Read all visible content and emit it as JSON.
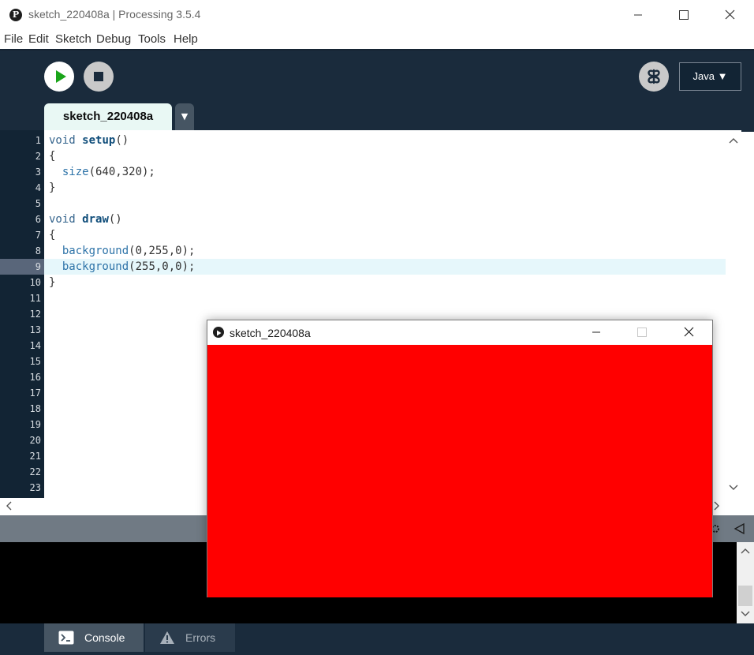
{
  "window": {
    "title": "sketch_220408a | Processing 3.5.4"
  },
  "menu": [
    "File",
    "Edit",
    "Sketch",
    "Debug",
    "Tools",
    "Help"
  ],
  "toolbar": {
    "mode": "Java ▼"
  },
  "tabs": {
    "active": "sketch_220408a",
    "menu_arrow": "▼"
  },
  "editor": {
    "line_numbers": [
      "1",
      "2",
      "3",
      "4",
      "5",
      "6",
      "7",
      "8",
      "9",
      "10",
      "11",
      "12",
      "13",
      "14",
      "15",
      "16",
      "17",
      "18",
      "19",
      "20",
      "21",
      "22",
      "23"
    ],
    "current_line": 9,
    "code": [
      [
        {
          "t": "void ",
          "c": "kw"
        },
        {
          "t": "setup",
          "c": "fn"
        },
        {
          "t": "()",
          "c": ""
        }
      ],
      [
        {
          "t": "{",
          "c": ""
        }
      ],
      [
        {
          "t": "  ",
          "c": ""
        },
        {
          "t": "size",
          "c": "fn2"
        },
        {
          "t": "(640,320);",
          "c": ""
        }
      ],
      [
        {
          "t": "}",
          "c": ""
        }
      ],
      [],
      [
        {
          "t": "void ",
          "c": "kw"
        },
        {
          "t": "draw",
          "c": "fn"
        },
        {
          "t": "()",
          "c": ""
        }
      ],
      [
        {
          "t": "{",
          "c": ""
        }
      ],
      [
        {
          "t": "  ",
          "c": ""
        },
        {
          "t": "background",
          "c": "fn2"
        },
        {
          "t": "(0,255,0);",
          "c": ""
        }
      ],
      [
        {
          "t": "  ",
          "c": ""
        },
        {
          "t": "background",
          "c": "fn2"
        },
        {
          "t": "(255,0,0);",
          "c": ""
        }
      ],
      [
        {
          "t": "}",
          "c": ""
        }
      ]
    ]
  },
  "footer": {
    "console_label": "Console",
    "errors_label": "Errors"
  },
  "sketch_window": {
    "title": "sketch_220408a",
    "canvas_color": "#ff0000"
  },
  "colors": {
    "toolbar_bg": "#1a2b3c",
    "run_green": "#1aa51a",
    "tab_active_bg": "#e9f8f4"
  }
}
